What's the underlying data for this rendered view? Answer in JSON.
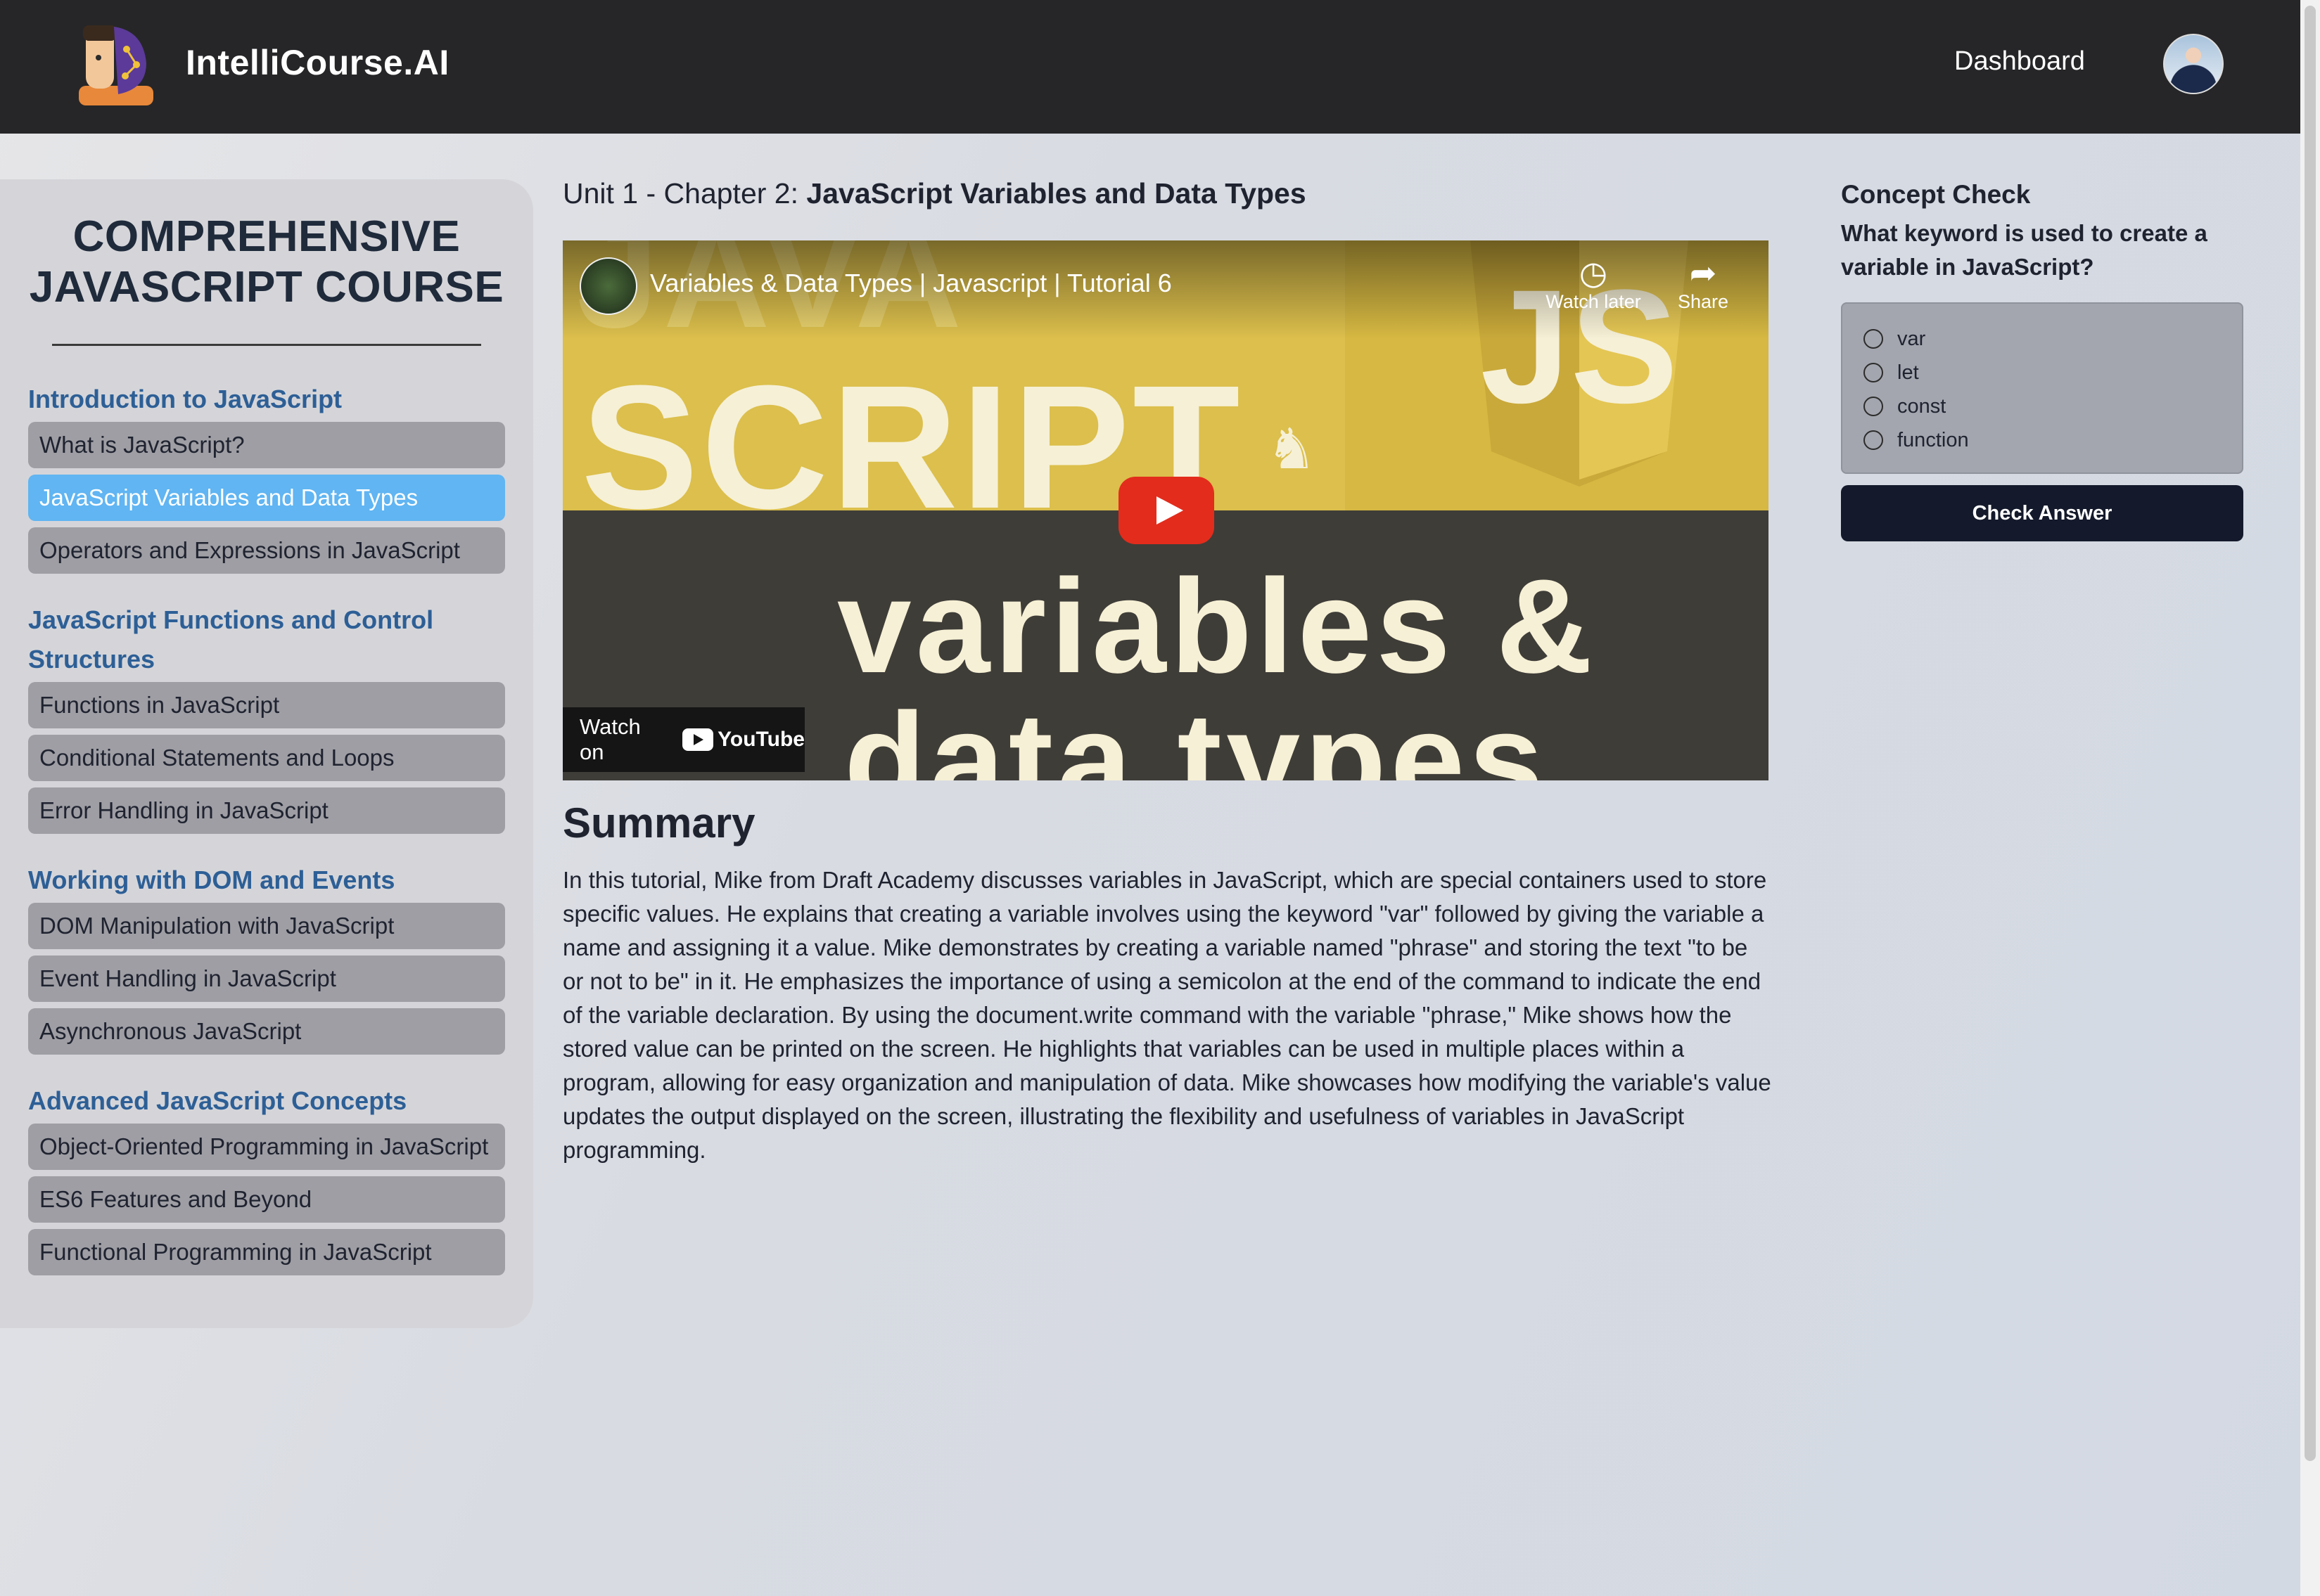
{
  "app": {
    "brand": "IntelliCourse.AI",
    "nav_dashboard": "Dashboard"
  },
  "sidebar": {
    "course_title": "COMPREHENSIVE JAVASCRIPT COURSE",
    "units": [
      {
        "title": "Introduction to JavaScript",
        "chapters": [
          "What is JavaScript?",
          "JavaScript Variables and Data Types",
          "Operators and Expressions in JavaScript"
        ]
      },
      {
        "title": "JavaScript Functions and Control Structures",
        "chapters": [
          "Functions in JavaScript",
          "Conditional Statements and Loops",
          "Error Handling in JavaScript"
        ]
      },
      {
        "title": "Working with DOM and Events",
        "chapters": [
          "DOM Manipulation with JavaScript",
          "Event Handling in JavaScript",
          "Asynchronous JavaScript"
        ]
      },
      {
        "title": "Advanced JavaScript Concepts",
        "chapters": [
          "Object-Oriented Programming in JavaScript",
          "ES6 Features and Beyond",
          "Functional Programming in JavaScript"
        ]
      }
    ],
    "active_chapter": "JavaScript Variables and Data Types"
  },
  "main": {
    "crumb_prefix": "Unit 1 - Chapter 2:",
    "chapter_title": "JavaScript Variables and Data Types",
    "video": {
      "title": "Variables & Data Types | Javascript | Tutorial 6",
      "watch_later": "Watch later",
      "share": "Share",
      "watch_on": "Watch on",
      "youtube": "YouTube",
      "thumb_java": "JAVA",
      "thumb_script": "SCRIPT",
      "thumb_js": "JS",
      "thumb_line1": "variables &",
      "thumb_line2": "data types"
    },
    "summary_heading": "Summary",
    "summary_text": "In this tutorial, Mike from Draft Academy discusses variables in JavaScript, which are special containers used to store specific values. He explains that creating a variable involves using the keyword \"var\" followed by giving the variable a name and assigning it a value. Mike demonstrates by creating a variable named \"phrase\" and storing the text \"to be or not to be\" in it. He emphasizes the importance of using a semicolon at the end of the command to indicate the end of the variable declaration. By using the document.write command with the variable \"phrase,\" Mike shows how the stored value can be printed on the screen. He highlights that variables can be used in multiple places within a program, allowing for easy organization and manipulation of data. Mike showcases how modifying the variable's value updates the output displayed on the screen, illustrating the flexibility and usefulness of variables in JavaScript programming."
  },
  "concept_check": {
    "title": "Concept Check",
    "question": "What keyword is used to create a variable in JavaScript?",
    "options": [
      "var",
      "let",
      "const",
      "function"
    ],
    "button": "Check Answer"
  },
  "colors": {
    "topbar": "#262628",
    "active_chapter": "#60b5f2",
    "unit_title": "#2d5f96",
    "button": "#141a2b"
  }
}
